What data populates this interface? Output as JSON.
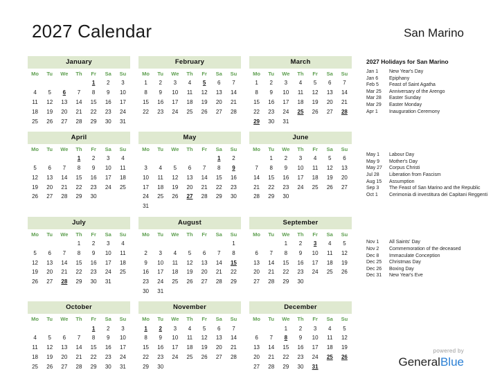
{
  "header": {
    "title": "2027 Calendar",
    "region": "San Marino"
  },
  "weekdays": [
    "Mo",
    "Tu",
    "We",
    "Th",
    "Fr",
    "Sa",
    "Su"
  ],
  "colors": {
    "month_header_bg": "#dfe9d0",
    "weekday_text": "#5d9e4f",
    "holiday_text": "#e8000d",
    "brand_blue": "#2a7fd4",
    "body_text": "#1a1a1a"
  },
  "months": [
    {
      "name": "January",
      "start_weekday_index": 4,
      "days_in_month": 31,
      "holiday_days": [
        1,
        6
      ]
    },
    {
      "name": "February",
      "start_weekday_index": 0,
      "days_in_month": 28,
      "holiday_days": [
        5
      ]
    },
    {
      "name": "March",
      "start_weekday_index": 0,
      "days_in_month": 31,
      "holiday_days": [
        25,
        28,
        29
      ]
    },
    {
      "name": "April",
      "start_weekday_index": 3,
      "days_in_month": 30,
      "holiday_days": [
        1
      ]
    },
    {
      "name": "May",
      "start_weekday_index": 5,
      "days_in_month": 31,
      "holiday_days": [
        1,
        9,
        27
      ]
    },
    {
      "name": "June",
      "start_weekday_index": 1,
      "days_in_month": 30,
      "holiday_days": []
    },
    {
      "name": "July",
      "start_weekday_index": 3,
      "days_in_month": 31,
      "holiday_days": [
        28
      ]
    },
    {
      "name": "August",
      "start_weekday_index": 6,
      "days_in_month": 31,
      "holiday_days": [
        15
      ]
    },
    {
      "name": "September",
      "start_weekday_index": 2,
      "days_in_month": 30,
      "holiday_days": [
        3
      ]
    },
    {
      "name": "October",
      "start_weekday_index": 4,
      "days_in_month": 31,
      "holiday_days": [
        1
      ]
    },
    {
      "name": "November",
      "start_weekday_index": 0,
      "days_in_month": 30,
      "holiday_days": [
        1,
        2
      ]
    },
    {
      "name": "December",
      "start_weekday_index": 2,
      "days_in_month": 31,
      "holiday_days": [
        8,
        25,
        26,
        31
      ]
    }
  ],
  "holidays_panel": {
    "title": "2027 Holidays for San Marino",
    "groups": [
      {
        "items": [
          {
            "date": "Jan 1",
            "name": "New Year's Day"
          },
          {
            "date": "Jan 6",
            "name": "Epiphany"
          },
          {
            "date": "Feb 5",
            "name": "Feast of Saint Agatha"
          },
          {
            "date": "Mar 25",
            "name": "Anniversary of the Arengo"
          },
          {
            "date": "Mar 28",
            "name": "Easter Sunday"
          },
          {
            "date": "Mar 29",
            "name": "Easter Monday"
          },
          {
            "date": "Apr 1",
            "name": "Inauguration Ceremony"
          }
        ]
      },
      {
        "items": [
          {
            "date": "May 1",
            "name": "Labour Day"
          },
          {
            "date": "May 9",
            "name": "Mother's Day"
          },
          {
            "date": "May 27",
            "name": "Corpus Christi"
          },
          {
            "date": "Jul 28",
            "name": "Liberation from Fascism"
          },
          {
            "date": "Aug 15",
            "name": "Assumption"
          },
          {
            "date": "Sep 3",
            "name": "The Feast of San Marino and the Republic"
          },
          {
            "date": "Oct 1",
            "name": "Cerimonia di investitura dei Capitani Reggenti"
          }
        ]
      },
      {
        "items": [
          {
            "date": "Nov 1",
            "name": "All Saints' Day"
          },
          {
            "date": "Nov 2",
            "name": "Commemoration of the deceased"
          },
          {
            "date": "Dec 8",
            "name": "Immaculate Conception"
          },
          {
            "date": "Dec 25",
            "name": "Christmas Day"
          },
          {
            "date": "Dec 26",
            "name": "Boxing Day"
          },
          {
            "date": "Dec 31",
            "name": "New Year's Eve"
          }
        ]
      }
    ]
  },
  "footer": {
    "powered_by": "powered by",
    "brand_first": "General",
    "brand_second": "Blue"
  }
}
